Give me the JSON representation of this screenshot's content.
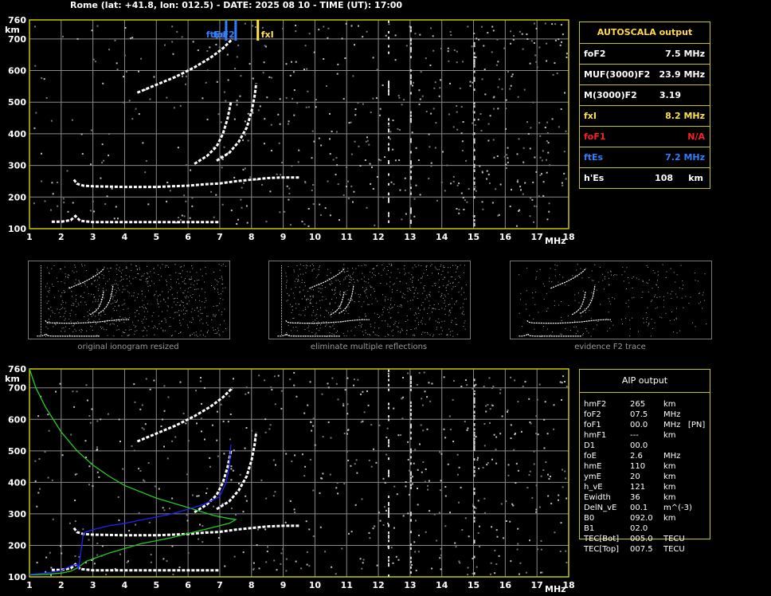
{
  "header": {
    "title": "Rome (lat: +41.8, lon: 012.5) - DATE: 2025 08 10 - TIME (UT): 17:00"
  },
  "colors": {
    "grid": "#8a8a8a",
    "frame": "#c8c800",
    "ftEs": "#2f7fff",
    "foF2": "#2f7fff",
    "fxI": "#ffe14a",
    "trace": "#ffffff",
    "green_profile": "#22cc22",
    "blue_profile": "#2020ff"
  },
  "chart_data": [
    {
      "type": "scatter",
      "name": "ionogram-top",
      "ylabel": "km",
      "xlabel": "MHz",
      "xlim": [
        1,
        18
      ],
      "ylim": [
        100,
        760
      ],
      "xticks": [
        1,
        2,
        3,
        4,
        5,
        6,
        7,
        8,
        9,
        10,
        11,
        12,
        13,
        14,
        15,
        16,
        17,
        18
      ],
      "yticks": [
        100,
        200,
        300,
        400,
        500,
        600,
        700,
        760
      ],
      "markers": [
        {
          "label": "ftEs",
          "freq": 7.2,
          "color": "#2f7fff"
        },
        {
          "label": "foF2",
          "freq": 7.5,
          "color": "#2f7fff"
        },
        {
          "label": "fxI",
          "freq": 8.2,
          "color": "#ffe14a"
        }
      ],
      "traces": [
        {
          "points": [
            [
              1.7,
              122
            ],
            [
              2.0,
              122
            ],
            [
              2.3,
              127
            ],
            [
              2.45,
              140
            ],
            [
              2.6,
              125
            ],
            [
              3.0,
              121
            ],
            [
              4.0,
              121
            ],
            [
              5.0,
              121
            ],
            [
              6.0,
              121
            ],
            [
              7.0,
              121
            ]
          ]
        },
        {
          "points": [
            [
              2.4,
              255
            ],
            [
              2.5,
              242
            ],
            [
              2.7,
              236
            ],
            [
              3.0,
              234
            ],
            [
              3.5,
              233
            ],
            [
              4.0,
              232
            ],
            [
              4.5,
              232
            ],
            [
              5.0,
              232
            ],
            [
              5.5,
              234
            ],
            [
              6.0,
              236
            ],
            [
              6.5,
              240
            ],
            [
              7.0,
              243
            ],
            [
              7.5,
              250
            ],
            [
              8.0,
              255
            ],
            [
              8.5,
              260
            ],
            [
              9.0,
              262
            ],
            [
              9.5,
              262
            ]
          ]
        },
        {
          "points": [
            [
              6.2,
              305
            ],
            [
              6.6,
              330
            ],
            [
              6.9,
              360
            ],
            [
              7.1,
              400
            ],
            [
              7.25,
              450
            ],
            [
              7.35,
              500
            ]
          ]
        },
        {
          "points": [
            [
              6.9,
              315
            ],
            [
              7.3,
              340
            ],
            [
              7.6,
              375
            ],
            [
              7.85,
              420
            ],
            [
              8.0,
              470
            ],
            [
              8.1,
              520
            ],
            [
              8.15,
              560
            ]
          ]
        },
        {
          "points": [
            [
              4.4,
              530
            ],
            [
              5.0,
              555
            ],
            [
              5.6,
              580
            ],
            [
              6.2,
              610
            ],
            [
              6.7,
              640
            ],
            [
              7.1,
              670
            ],
            [
              7.4,
              700
            ]
          ]
        }
      ]
    },
    {
      "type": "table",
      "name": "autoscala-output",
      "title": "AUTOSCALA output",
      "rows": [
        {
          "key": "foF2",
          "value": "7.5 MHz",
          "color": "#ffffff"
        },
        {
          "key": "MUF(3000)F2",
          "value": "23.9 MHz",
          "color": "#ffffff"
        },
        {
          "key": "M(3000)F2",
          "value": "3.19",
          "color": "#ffffff"
        },
        {
          "key": "fxI",
          "value": "8.2 MHz",
          "color": "#ffe14a"
        },
        {
          "key": "foF1",
          "value": "N/A",
          "color": "#ff2020"
        },
        {
          "key": "ftEs",
          "value": "7.2 MHz",
          "color": "#2f7fff"
        },
        {
          "key": "h'Es",
          "value": "108     km",
          "color": "#ffffff"
        }
      ]
    },
    {
      "type": "scatter",
      "name": "ionogram-bottom",
      "ylabel": "km",
      "xlabel": "MHz",
      "xlim": [
        1,
        18
      ],
      "ylim": [
        100,
        760
      ],
      "xticks": [
        1,
        2,
        3,
        4,
        5,
        6,
        7,
        8,
        9,
        10,
        11,
        12,
        13,
        14,
        15,
        16,
        17,
        18
      ],
      "yticks": [
        100,
        200,
        300,
        400,
        500,
        600,
        700,
        760
      ],
      "green_profile": [
        [
          1.0,
          760
        ],
        [
          1.2,
          700
        ],
        [
          1.5,
          640
        ],
        [
          2.0,
          560
        ],
        [
          2.5,
          500
        ],
        [
          3.0,
          455
        ],
        [
          3.5,
          420
        ],
        [
          4.0,
          390
        ],
        [
          5.0,
          350
        ],
        [
          6.0,
          320
        ],
        [
          6.8,
          295
        ],
        [
          7.3,
          285
        ],
        [
          7.5,
          282
        ],
        [
          7.3,
          270
        ],
        [
          6.5,
          250
        ],
        [
          5.5,
          225
        ],
        [
          4.5,
          205
        ],
        [
          3.5,
          175
        ],
        [
          2.8,
          150
        ],
        [
          2.5,
          128
        ],
        [
          2.3,
          118
        ],
        [
          2.0,
          112
        ],
        [
          1.5,
          108
        ],
        [
          1.0,
          106
        ]
      ],
      "blue_profile": [
        [
          1.0,
          108
        ],
        [
          1.5,
          112
        ],
        [
          2.0,
          120
        ],
        [
          2.3,
          135
        ],
        [
          2.5,
          140
        ],
        [
          2.55,
          125
        ],
        [
          2.7,
          240
        ],
        [
          3.0,
          250
        ],
        [
          3.5,
          262
        ],
        [
          4.0,
          270
        ],
        [
          4.5,
          280
        ],
        [
          5.0,
          290
        ],
        [
          5.5,
          300
        ],
        [
          6.0,
          315
        ],
        [
          6.5,
          330
        ],
        [
          7.0,
          355
        ],
        [
          7.2,
          400
        ],
        [
          7.3,
          450
        ],
        [
          7.35,
          520
        ]
      ]
    },
    {
      "type": "table",
      "name": "aip-output",
      "title": "AIP output",
      "rows": [
        {
          "key": "hmF2",
          "value": "265",
          "unit": "km"
        },
        {
          "key": "foF2",
          "value": "07.5",
          "unit": "MHz"
        },
        {
          "key": "foF1",
          "value": "00.0",
          "unit": "MHz   [PN]"
        },
        {
          "key": "hmF1",
          "value": "---",
          "unit": "km"
        },
        {
          "key": "D1",
          "value": "00.0",
          "unit": ""
        },
        {
          "key": "foE",
          "value": "2.6",
          "unit": "MHz"
        },
        {
          "key": "hmE",
          "value": "110",
          "unit": "km"
        },
        {
          "key": "ymE",
          "value": "20",
          "unit": "km"
        },
        {
          "key": "h_vE",
          "value": "121",
          "unit": "km"
        },
        {
          "key": "Ewidth",
          "value": "36",
          "unit": "km"
        },
        {
          "key": "DelN_vE",
          "value": "00.1",
          "unit": "m^(-3)"
        },
        {
          "key": "B0",
          "value": "092.0",
          "unit": "km"
        },
        {
          "key": "B1",
          "value": "02.0",
          "unit": ""
        },
        {
          "key": "TEC[Bot]",
          "value": "005.0",
          "unit": "TECU"
        },
        {
          "key": "TEC[Top]",
          "value": "007.5",
          "unit": "TECU"
        }
      ]
    }
  ],
  "thumbnails": [
    {
      "caption": "original ionogram resized"
    },
    {
      "caption": "eliminate multiple reflections"
    },
    {
      "caption": "evidence F2 trace"
    }
  ]
}
